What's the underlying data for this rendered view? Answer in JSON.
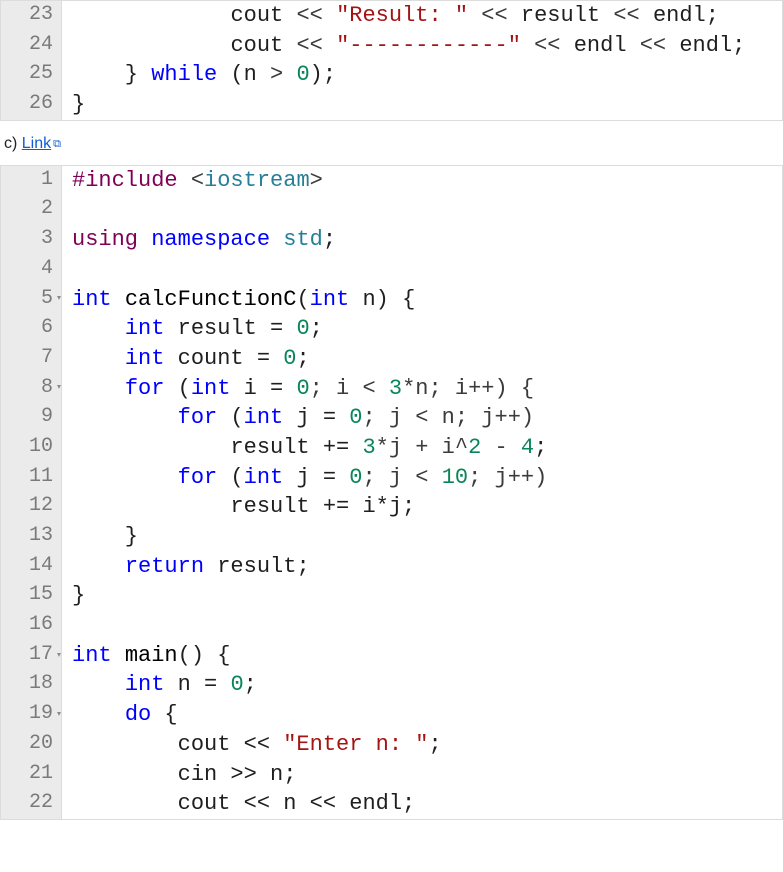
{
  "block1": {
    "lines": [
      {
        "num": "23",
        "fold": false,
        "tokens": [
          {
            "t": "            ",
            "c": ""
          },
          {
            "t": "cout",
            "c": "tok-id"
          },
          {
            "t": " << ",
            "c": "tok-op"
          },
          {
            "t": "\"Result: \"",
            "c": "tok-str"
          },
          {
            "t": " << ",
            "c": "tok-op"
          },
          {
            "t": "result",
            "c": "tok-id"
          },
          {
            "t": " << ",
            "c": "tok-op"
          },
          {
            "t": "endl",
            "c": "tok-id"
          },
          {
            "t": ";",
            "c": "tok-punc"
          }
        ]
      },
      {
        "num": "24",
        "fold": false,
        "tokens": [
          {
            "t": "            ",
            "c": ""
          },
          {
            "t": "cout",
            "c": "tok-id"
          },
          {
            "t": " << ",
            "c": "tok-op"
          },
          {
            "t": "\"------------\"",
            "c": "tok-str"
          },
          {
            "t": " << ",
            "c": "tok-op"
          },
          {
            "t": "endl",
            "c": "tok-id"
          },
          {
            "t": " << ",
            "c": "tok-op"
          },
          {
            "t": "endl",
            "c": "tok-id"
          },
          {
            "t": ";",
            "c": "tok-punc"
          }
        ]
      },
      {
        "num": "25",
        "fold": false,
        "tokens": [
          {
            "t": "    } ",
            "c": "tok-punc"
          },
          {
            "t": "while",
            "c": "tok-kw2"
          },
          {
            "t": " (",
            "c": "tok-punc"
          },
          {
            "t": "n",
            "c": "tok-id"
          },
          {
            "t": " > ",
            "c": "tok-op"
          },
          {
            "t": "0",
            "c": "tok-num"
          },
          {
            "t": ");",
            "c": "tok-punc"
          }
        ]
      },
      {
        "num": "26",
        "fold": false,
        "tokens": [
          {
            "t": "}",
            "c": "tok-punc"
          }
        ]
      }
    ]
  },
  "caption": {
    "prefix": "c) ",
    "link_text": "Link"
  },
  "block2": {
    "lines": [
      {
        "num": "1",
        "fold": false,
        "tokens": [
          {
            "t": "#include",
            "c": "tok-kw"
          },
          {
            "t": " <",
            "c": "tok-op"
          },
          {
            "t": "iostream",
            "c": "tok-type"
          },
          {
            "t": ">",
            "c": "tok-op"
          }
        ]
      },
      {
        "num": "2",
        "fold": false,
        "tokens": [
          {
            "t": " ",
            "c": ""
          }
        ]
      },
      {
        "num": "3",
        "fold": false,
        "tokens": [
          {
            "t": "using",
            "c": "tok-kw"
          },
          {
            "t": " ",
            "c": ""
          },
          {
            "t": "namespace",
            "c": "tok-kw2"
          },
          {
            "t": " ",
            "c": ""
          },
          {
            "t": "std",
            "c": "tok-type"
          },
          {
            "t": ";",
            "c": "tok-punc"
          }
        ]
      },
      {
        "num": "4",
        "fold": false,
        "tokens": [
          {
            "t": " ",
            "c": ""
          }
        ]
      },
      {
        "num": "5",
        "fold": true,
        "tokens": [
          {
            "t": "int",
            "c": "tok-kw2"
          },
          {
            "t": " ",
            "c": ""
          },
          {
            "t": "calcFunctionC",
            "c": "tok-fn"
          },
          {
            "t": "(",
            "c": "tok-punc"
          },
          {
            "t": "int",
            "c": "tok-kw2"
          },
          {
            "t": " n",
            "c": "tok-id"
          },
          {
            "t": ") {",
            "c": "tok-punc"
          }
        ]
      },
      {
        "num": "6",
        "fold": false,
        "tokens": [
          {
            "t": "    ",
            "c": ""
          },
          {
            "t": "int",
            "c": "tok-kw2"
          },
          {
            "t": " result = ",
            "c": "tok-id"
          },
          {
            "t": "0",
            "c": "tok-num"
          },
          {
            "t": ";",
            "c": "tok-punc"
          }
        ]
      },
      {
        "num": "7",
        "fold": false,
        "tokens": [
          {
            "t": "    ",
            "c": ""
          },
          {
            "t": "int",
            "c": "tok-kw2"
          },
          {
            "t": " count = ",
            "c": "tok-id"
          },
          {
            "t": "0",
            "c": "tok-num"
          },
          {
            "t": ";",
            "c": "tok-punc"
          }
        ]
      },
      {
        "num": "8",
        "fold": true,
        "tokens": [
          {
            "t": "    ",
            "c": ""
          },
          {
            "t": "for",
            "c": "tok-kw2"
          },
          {
            "t": " (",
            "c": "tok-punc"
          },
          {
            "t": "int",
            "c": "tok-kw2"
          },
          {
            "t": " i = ",
            "c": "tok-id"
          },
          {
            "t": "0",
            "c": "tok-num"
          },
          {
            "t": "; i < ",
            "c": "tok-op"
          },
          {
            "t": "3",
            "c": "tok-num"
          },
          {
            "t": "*n; i++) {",
            "c": "tok-op"
          }
        ]
      },
      {
        "num": "9",
        "fold": false,
        "tokens": [
          {
            "t": "        ",
            "c": ""
          },
          {
            "t": "for",
            "c": "tok-kw2"
          },
          {
            "t": " (",
            "c": "tok-punc"
          },
          {
            "t": "int",
            "c": "tok-kw2"
          },
          {
            "t": " j = ",
            "c": "tok-id"
          },
          {
            "t": "0",
            "c": "tok-num"
          },
          {
            "t": "; j < n; j++)",
            "c": "tok-op"
          }
        ]
      },
      {
        "num": "10",
        "fold": false,
        "tokens": [
          {
            "t": "            result += ",
            "c": "tok-id"
          },
          {
            "t": "3",
            "c": "tok-num"
          },
          {
            "t": "*j + i^",
            "c": "tok-op"
          },
          {
            "t": "2",
            "c": "tok-num"
          },
          {
            "t": " - ",
            "c": "tok-op"
          },
          {
            "t": "4",
            "c": "tok-num"
          },
          {
            "t": ";",
            "c": "tok-punc"
          }
        ]
      },
      {
        "num": "11",
        "fold": false,
        "tokens": [
          {
            "t": "        ",
            "c": ""
          },
          {
            "t": "for",
            "c": "tok-kw2"
          },
          {
            "t": " (",
            "c": "tok-punc"
          },
          {
            "t": "int",
            "c": "tok-kw2"
          },
          {
            "t": " j = ",
            "c": "tok-id"
          },
          {
            "t": "0",
            "c": "tok-num"
          },
          {
            "t": "; j < ",
            "c": "tok-op"
          },
          {
            "t": "10",
            "c": "tok-num"
          },
          {
            "t": "; j++)",
            "c": "tok-op"
          }
        ]
      },
      {
        "num": "12",
        "fold": false,
        "tokens": [
          {
            "t": "            result += i*j;",
            "c": "tok-id"
          }
        ]
      },
      {
        "num": "13",
        "fold": false,
        "tokens": [
          {
            "t": "    }",
            "c": "tok-punc"
          }
        ]
      },
      {
        "num": "14",
        "fold": false,
        "tokens": [
          {
            "t": "    ",
            "c": ""
          },
          {
            "t": "return",
            "c": "tok-kw2"
          },
          {
            "t": " result;",
            "c": "tok-id"
          }
        ]
      },
      {
        "num": "15",
        "fold": false,
        "tokens": [
          {
            "t": "}",
            "c": "tok-punc"
          }
        ]
      },
      {
        "num": "16",
        "fold": false,
        "tokens": [
          {
            "t": " ",
            "c": ""
          }
        ]
      },
      {
        "num": "17",
        "fold": true,
        "tokens": [
          {
            "t": "int",
            "c": "tok-kw2"
          },
          {
            "t": " ",
            "c": ""
          },
          {
            "t": "main",
            "c": "tok-fn"
          },
          {
            "t": "() {",
            "c": "tok-punc"
          }
        ]
      },
      {
        "num": "18",
        "fold": false,
        "tokens": [
          {
            "t": "    ",
            "c": ""
          },
          {
            "t": "int",
            "c": "tok-kw2"
          },
          {
            "t": " n = ",
            "c": "tok-id"
          },
          {
            "t": "0",
            "c": "tok-num"
          },
          {
            "t": ";",
            "c": "tok-punc"
          }
        ]
      },
      {
        "num": "19",
        "fold": true,
        "tokens": [
          {
            "t": "    ",
            "c": ""
          },
          {
            "t": "do",
            "c": "tok-kw2"
          },
          {
            "t": " {",
            "c": "tok-punc"
          }
        ]
      },
      {
        "num": "20",
        "fold": false,
        "tokens": [
          {
            "t": "        cout << ",
            "c": "tok-id"
          },
          {
            "t": "\"Enter n: \"",
            "c": "tok-str"
          },
          {
            "t": ";",
            "c": "tok-punc"
          }
        ]
      },
      {
        "num": "21",
        "fold": false,
        "tokens": [
          {
            "t": "        cin >> n;",
            "c": "tok-id"
          }
        ]
      },
      {
        "num": "22",
        "fold": false,
        "tokens": [
          {
            "t": "        cout << n << endl;",
            "c": "tok-id"
          }
        ]
      }
    ]
  }
}
